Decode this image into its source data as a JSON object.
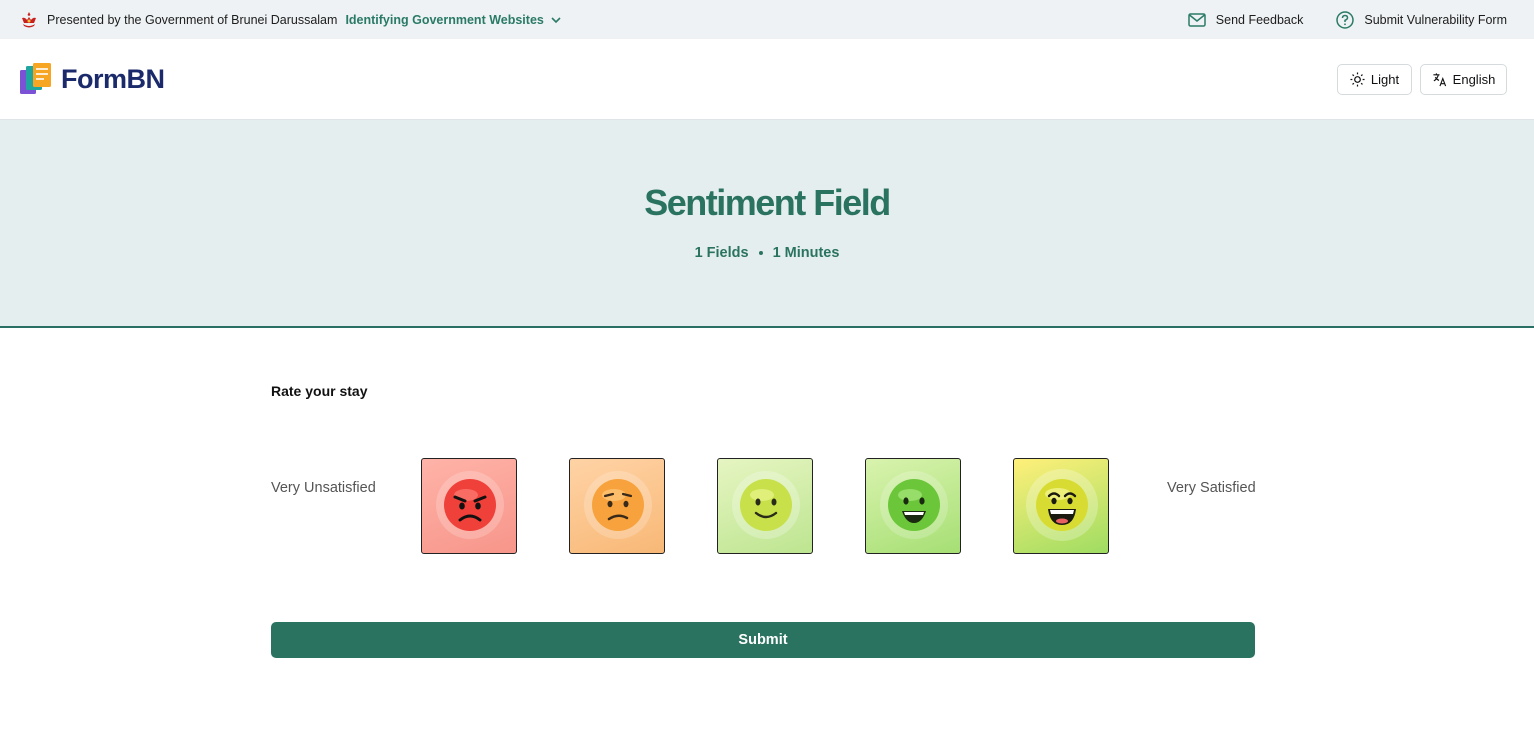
{
  "gov_banner": {
    "presented_by": "Presented by the Government of Brunei Darussalam",
    "identify_link": "Identifying Government Websites",
    "send_feedback": "Send Feedback",
    "submit_vulnerability": "Submit Vulnerability Form"
  },
  "header": {
    "logo_text": "FormBN",
    "theme_label": "Light",
    "language_label": "English"
  },
  "hero": {
    "title": "Sentiment Field",
    "fields": "1 Fields",
    "minutes": "1 Minutes"
  },
  "question": {
    "label": "Rate your stay",
    "min_label": "Very Unsatisfied",
    "max_label": "Very Satisfied",
    "options": [
      {
        "icon": "angry-face-icon"
      },
      {
        "icon": "sad-face-icon"
      },
      {
        "icon": "slight-smile-face-icon"
      },
      {
        "icon": "happy-face-icon"
      },
      {
        "icon": "very-happy-face-icon"
      }
    ]
  },
  "submit_label": "Submit",
  "colors": {
    "brand": "#2a7360",
    "hero_bg": "#e5eeee",
    "banner_bg": "#eef2f4"
  }
}
